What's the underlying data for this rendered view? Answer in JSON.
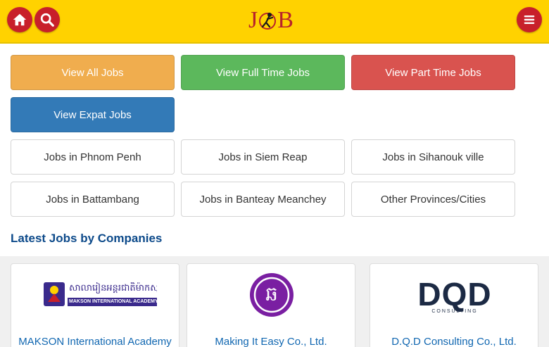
{
  "header": {
    "logo_letters": [
      "J",
      "B"
    ],
    "home_icon": "home-icon",
    "search_icon": "search-icon",
    "menu_icon": "menu-icon"
  },
  "job_types": [
    {
      "label": "View All Jobs",
      "color": "#f0ad4e"
    },
    {
      "label": "View Full Time Jobs",
      "color": "#5cb85c"
    },
    {
      "label": "View Part Time Jobs",
      "color": "#d9534f"
    },
    {
      "label": "View Expat Jobs",
      "color": "#337ab7"
    }
  ],
  "locations": [
    "Jobs in Phnom Penh",
    "Jobs in Siem Reap",
    "Jobs in Sihanouk ville",
    "Jobs in Battambang",
    "Jobs in Banteay Meanchey",
    "Other Provinces/Cities"
  ],
  "companies_section": {
    "title": "Latest Jobs by Companies"
  },
  "companies": [
    {
      "name": "MAKSON International Academy",
      "logo_text": "MAKSON INTERNATIONAL ACADEMY",
      "logo_script": "សាលារៀនអន្តរជាតិម៉ាកសុន"
    },
    {
      "name": "Making It Easy Co., Ltd.",
      "logo_glyph": "ឆ"
    },
    {
      "name": "D.Q.D Consulting Co., Ltd.",
      "logo_text": "DQD",
      "logo_subtext": "CONSULTING"
    }
  ],
  "colors": {
    "header_bg": "#ffd200",
    "accent_red": "#c8202a",
    "link_blue": "#1167b1",
    "title_blue": "#0d4a8a"
  }
}
